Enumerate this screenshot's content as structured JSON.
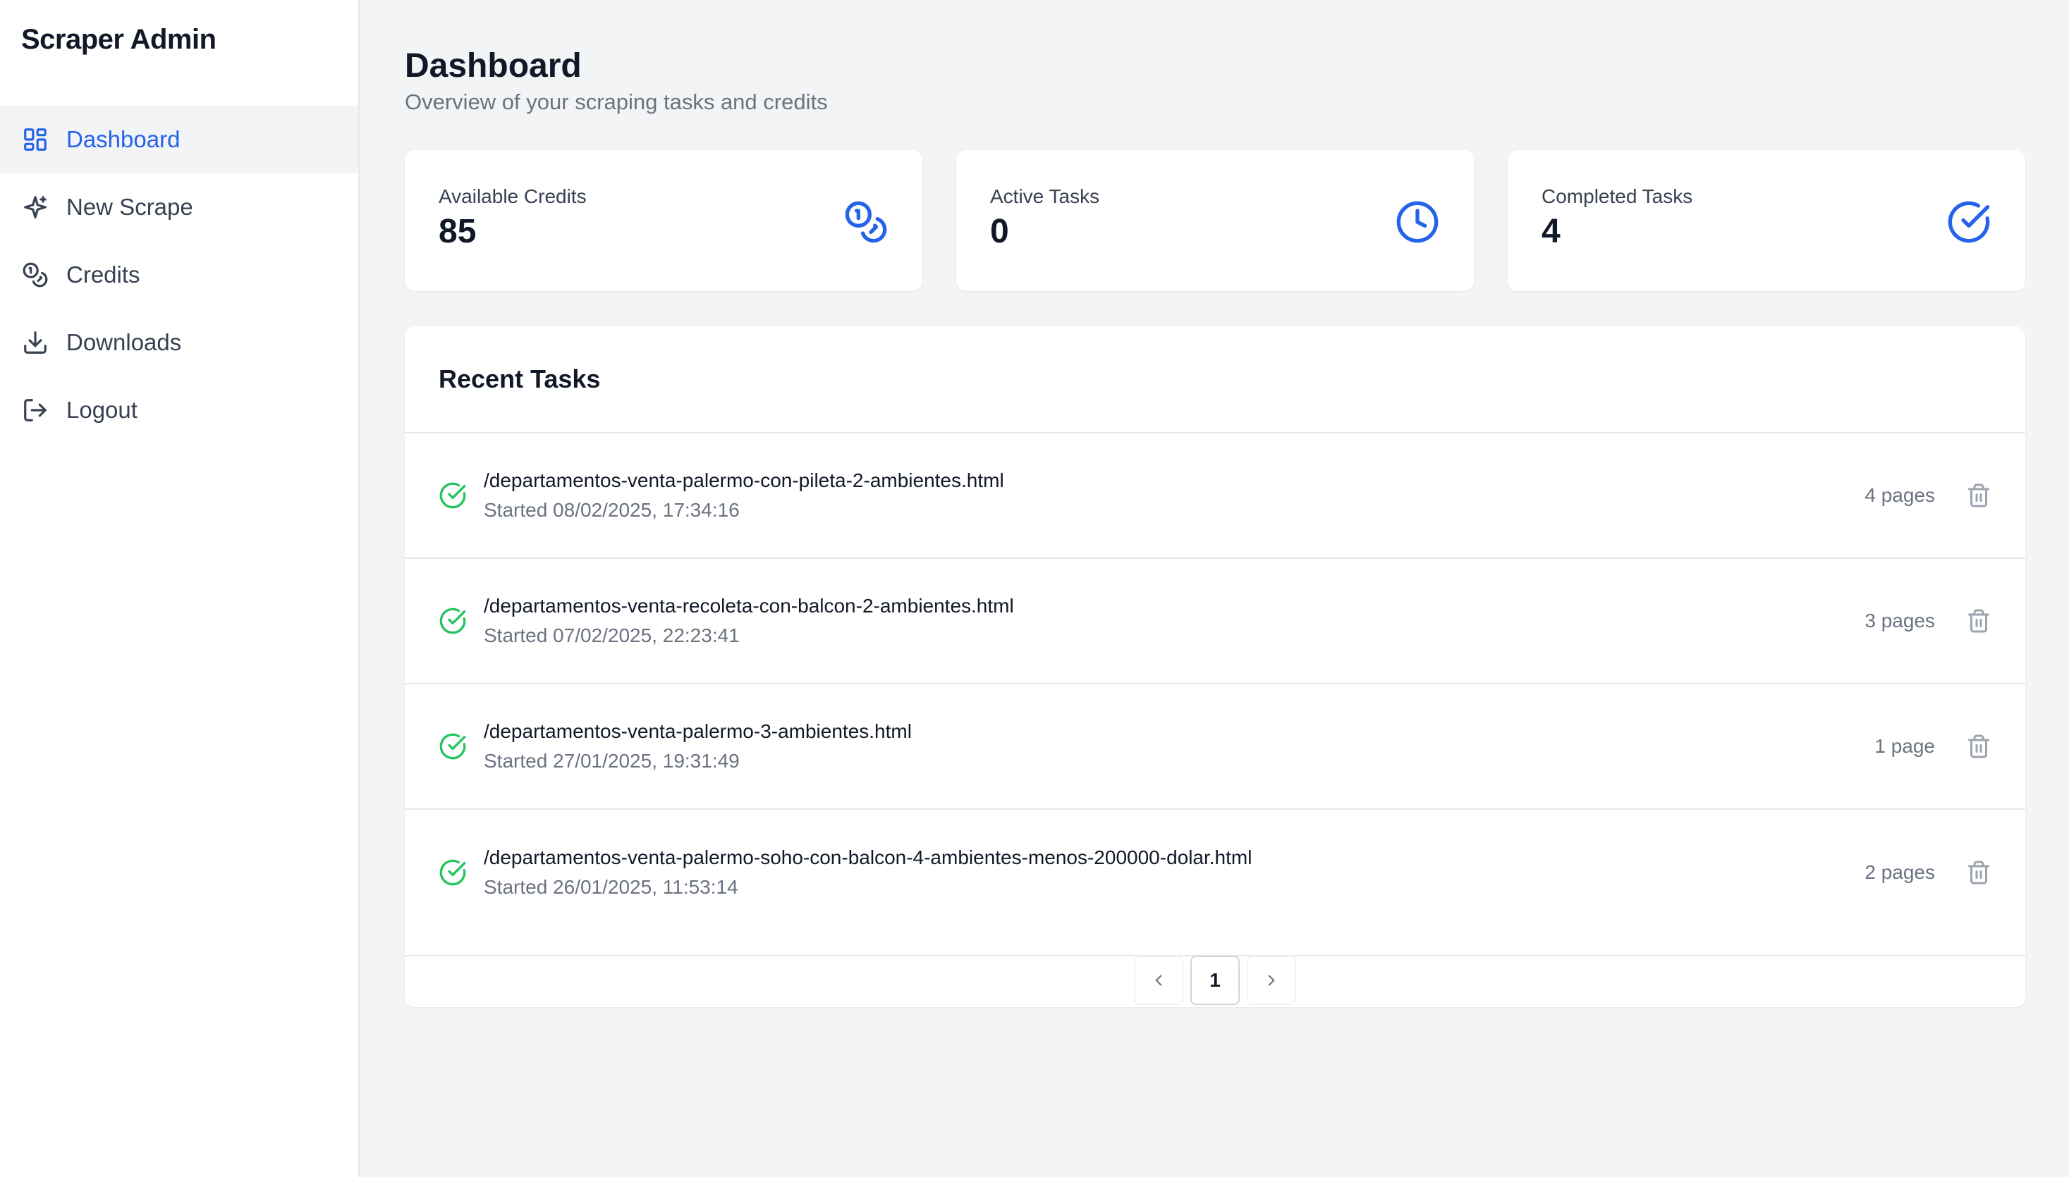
{
  "sidebar": {
    "brand": "Scraper Admin",
    "items": [
      {
        "label": "Dashboard",
        "icon": "layout-dashboard-icon",
        "active": true
      },
      {
        "label": "New Scrape",
        "icon": "sparkles-icon",
        "active": false
      },
      {
        "label": "Credits",
        "icon": "coins-icon",
        "active": false
      },
      {
        "label": "Downloads",
        "icon": "download-icon",
        "active": false
      },
      {
        "label": "Logout",
        "icon": "logout-icon",
        "active": false
      }
    ]
  },
  "header": {
    "title": "Dashboard",
    "subtitle": "Overview of your scraping tasks and credits"
  },
  "stats": [
    {
      "label": "Available Credits",
      "value": "85",
      "icon": "coins-icon"
    },
    {
      "label": "Active Tasks",
      "value": "0",
      "icon": "clock-icon"
    },
    {
      "label": "Completed Tasks",
      "value": "4",
      "icon": "check-circle-icon"
    }
  ],
  "recent_tasks": {
    "title": "Recent Tasks",
    "rows": [
      {
        "url": "/departamentos-venta-palermo-con-pileta-2-ambientes.html",
        "started": "Started 08/02/2025, 17:34:16",
        "pages": "4 pages"
      },
      {
        "url": "/departamentos-venta-recoleta-con-balcon-2-ambientes.html",
        "started": "Started 07/02/2025, 22:23:41",
        "pages": "3 pages"
      },
      {
        "url": "/departamentos-venta-palermo-3-ambientes.html",
        "started": "Started 27/01/2025, 19:31:49",
        "pages": "1 page"
      },
      {
        "url": "/departamentos-venta-palermo-soho-con-balcon-4-ambientes-menos-200000-dolar.html",
        "started": "Started 26/01/2025, 11:53:14",
        "pages": "2 pages"
      }
    ]
  },
  "pagination": {
    "current_page": "1"
  },
  "colors": {
    "accent": "#2563eb",
    "success": "#22c55e",
    "muted": "#6b7280",
    "background": "#f3f4f6"
  }
}
